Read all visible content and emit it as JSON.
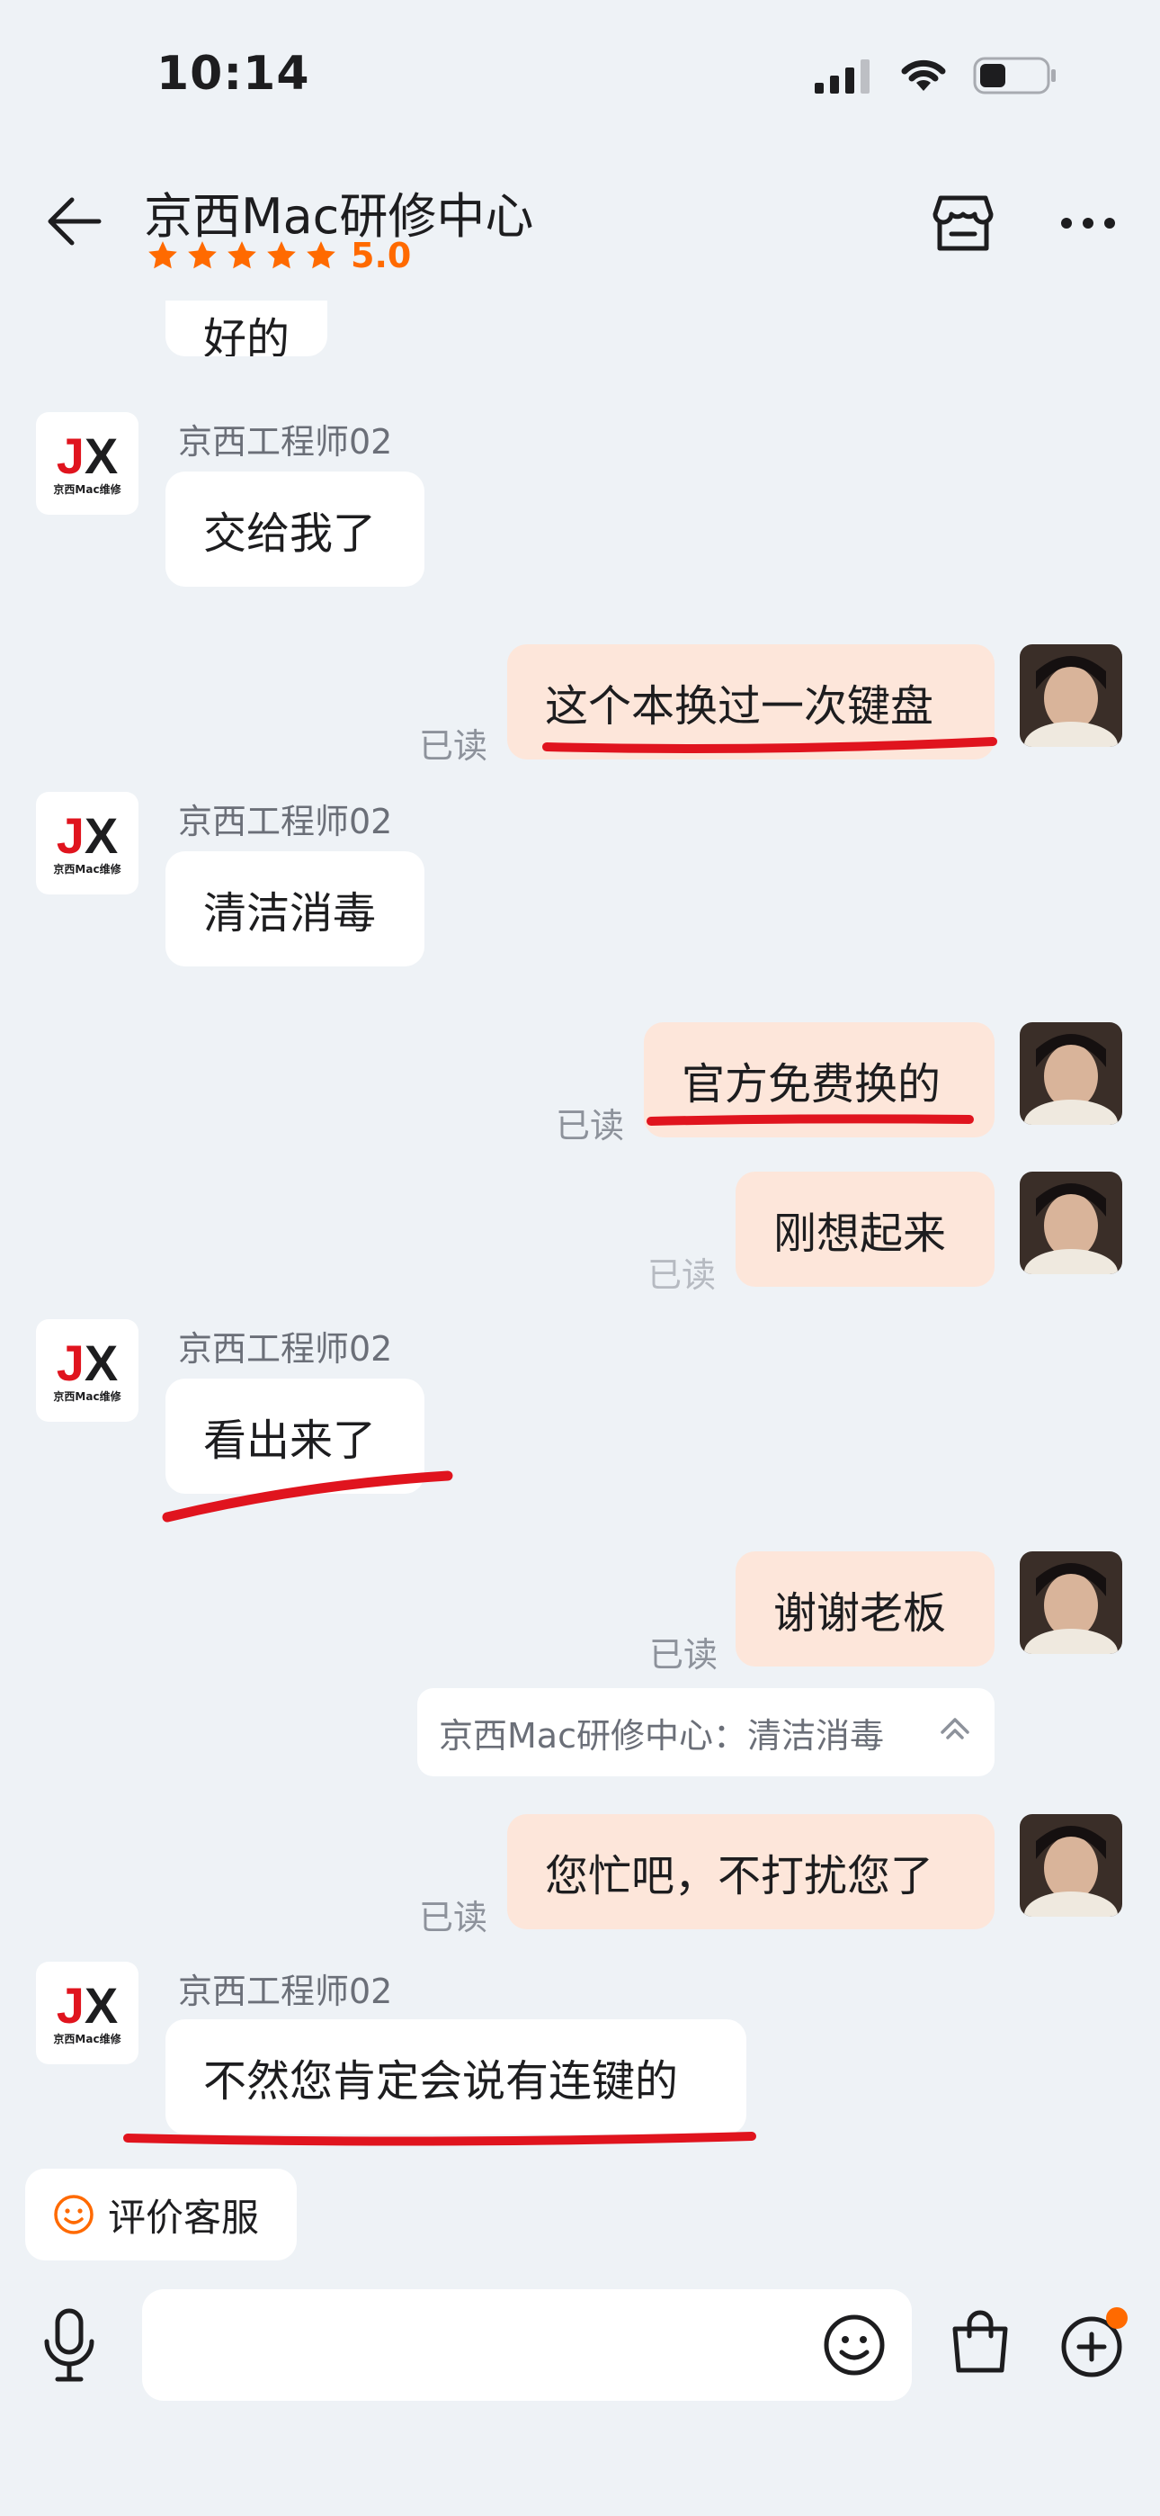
{
  "status_bar": {
    "time": "10:14"
  },
  "nav": {
    "title": "京西Mac研修中心",
    "rating": "5.0"
  },
  "messages": {
    "m0": {
      "text": "好的"
    },
    "m1": {
      "sender": "京西工程师02",
      "text": "交给我了"
    },
    "m2": {
      "text": "这个本换过一次键盘",
      "read": "已读"
    },
    "m3": {
      "sender": "京西工程师02",
      "text": "清洁消毒"
    },
    "m4": {
      "text": "官方免费换的",
      "read": "已读"
    },
    "m5": {
      "text": "刚想起来",
      "read": "已读"
    },
    "m6": {
      "sender": "京西工程师02",
      "text": "看出来了"
    },
    "m7": {
      "text": "谢谢老板",
      "read": "已读"
    },
    "m8": {
      "quote": "京西Mac研修中心：清洁消毒"
    },
    "m9": {
      "text": "您忙吧，不打扰您了",
      "read": "已读"
    },
    "m10": {
      "sender": "京西工程师02",
      "text": "不然您肯定会说有连键的"
    }
  },
  "logo": {
    "mark": "JX",
    "caption": "京西Mac维修"
  },
  "actions": {
    "rate_service": "评价客服"
  },
  "colors": {
    "accent": "#ff6a00",
    "outgoing_bubble": "#fde6da",
    "underline": "#e0141e"
  },
  "icons": [
    "back-arrow-icon",
    "shop-icon",
    "more-icon",
    "smile-icon",
    "microphone-icon",
    "emoji-icon",
    "bag-icon",
    "plus-icon"
  ]
}
